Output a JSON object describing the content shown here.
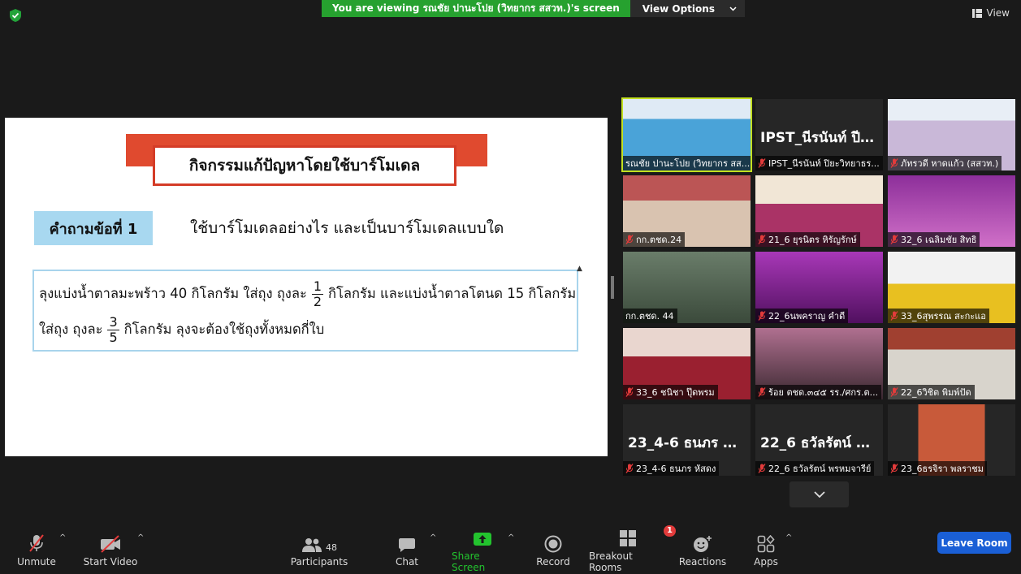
{
  "banner": {
    "viewing_text": "You are viewing รณชัย ปานะโปย (วิทยากร สสวท.)'s screen",
    "view_options": "View Options"
  },
  "top_right": {
    "view_label": "View"
  },
  "slide": {
    "title": "กิจกรรมแก้ปัญหาโดยใช้บาร์โมเดล",
    "question_label": "คำถามข้อที่ 1",
    "question_text": "ใช้บาร์โมเดลอย่างไร และเป็นบาร์โมเดลแบบใด",
    "problem": {
      "line1_a": "ลุงแบ่งน้ำตาลมะพร้าว 40 กิโลกรัม ใส่ถุง ถุงละ",
      "frac1_num": "1",
      "frac1_den": "2",
      "line1_b": "กิโลกรัม และแบ่งน้ำตาลโตนด 15 กิโลกรัม",
      "line2_a": "ใส่ถุง ถุงละ",
      "frac2_num": "3",
      "frac2_den": "5",
      "line2_b": "กิโลกรัม  ลุงจะต้องใช้ถุงทั้งหมดกี่ใบ"
    },
    "colors": {
      "title_red": "#e04a2f",
      "label_blue": "#a8d8f0",
      "box_border": "#a8d4ec"
    }
  },
  "participants_grid": [
    {
      "name": "รณชัย ปานะโปย (วิทยากร สส...",
      "display": "",
      "muted": false,
      "active": true
    },
    {
      "name": "IPST_นีรนันท์ ปิยะวิทยาธร...",
      "display": "IPST_นีรนันท์ ปีย...",
      "muted": true,
      "active": false
    },
    {
      "name": "ภัทรวดี หาดแก้ว (สสวท.)",
      "display": "",
      "muted": true,
      "active": false
    },
    {
      "name": "กก.ตชด.24",
      "display": "",
      "muted": true,
      "active": false
    },
    {
      "name": "21_6 ยุรนิตร หิรัญรักษ์",
      "display": "",
      "muted": true,
      "active": false
    },
    {
      "name": "32_6 เฉลิมชัย สิทธิ",
      "display": "",
      "muted": true,
      "active": false
    },
    {
      "name": "กก.ตชด. 44",
      "display": "",
      "muted": false,
      "active": false
    },
    {
      "name": "22_6นพคราญ  คำดี",
      "display": "",
      "muted": true,
      "active": false
    },
    {
      "name": "33_6สุพรรณ สะกะแอ",
      "display": "",
      "muted": true,
      "active": false
    },
    {
      "name": "33_6 ชนิชา ปุ๊ดพรม",
      "display": "",
      "muted": true,
      "active": false
    },
    {
      "name": "ร้อย ตชด.๓๔๕ รร./ศกร.ต...",
      "display": "",
      "muted": true,
      "active": false
    },
    {
      "name": "22_6วิชิต พิมพ์ปัด",
      "display": "",
      "muted": true,
      "active": false
    },
    {
      "name": "23_4-6 ธนภร  หัสดง",
      "display": "23_4-6 ธนภร  หั...",
      "muted": true,
      "active": false
    },
    {
      "name": "22_6 ธวัลรัตน์  พรหมจารีย์",
      "display": "22_6 ธวัลรัตน์  พ...",
      "muted": true,
      "active": false
    },
    {
      "name": "23_6ธรจิรา พลราชม",
      "display": "",
      "muted": true,
      "active": false
    }
  ],
  "toolbar": {
    "unmute": "Unmute",
    "start_video": "Start Video",
    "participants": "Participants",
    "participants_count": "48",
    "chat": "Chat",
    "share_screen": "Share Screen",
    "record": "Record",
    "breakout_rooms": "Breakout Rooms",
    "breakout_badge": "1",
    "reactions": "Reactions",
    "apps": "Apps",
    "leave_room": "Leave Room",
    "colors": {
      "share_green": "#23c32e",
      "leave_blue": "#1a5fd6"
    }
  }
}
